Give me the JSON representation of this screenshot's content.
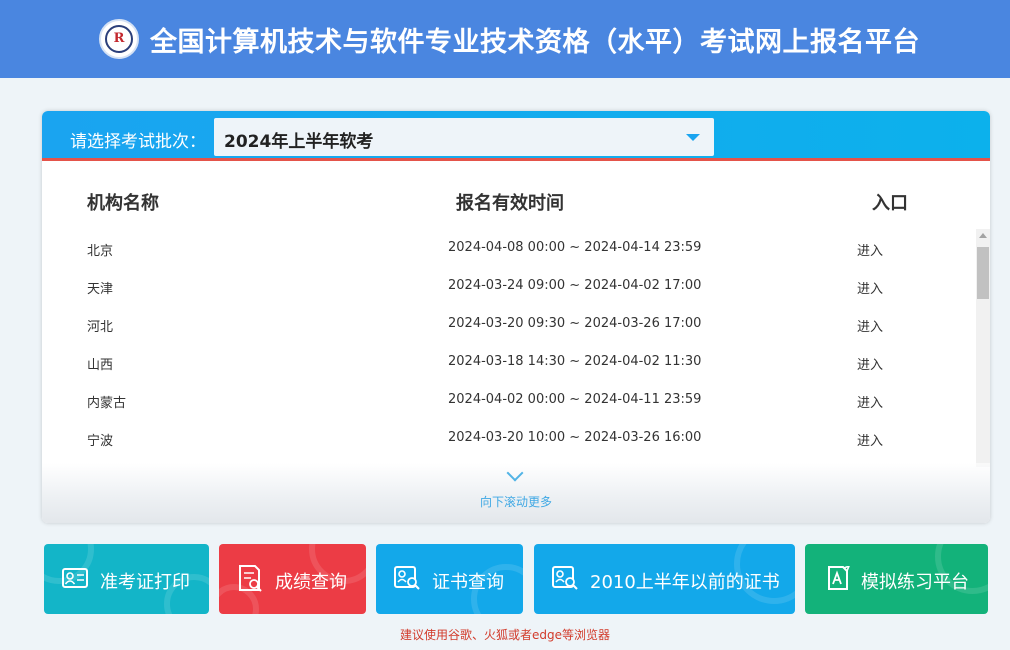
{
  "header": {
    "title": "全国计算机技术与软件专业技术资格（水平）考试网上报名平台",
    "logo_icon": "exam-logo-icon"
  },
  "batch": {
    "label": "请选择考试批次：",
    "selected": "2024年上半年软考"
  },
  "table": {
    "headers": {
      "name": "机构名称",
      "time": "报名有效时间",
      "entry": "入口"
    },
    "rows": [
      {
        "name": "北京",
        "time": "2024-04-08 00:00 ~ 2024-04-14 23:59",
        "entry": "进入"
      },
      {
        "name": "天津",
        "time": "2024-03-24 09:00 ~ 2024-04-02 17:00",
        "entry": "进入"
      },
      {
        "name": "河北",
        "time": "2024-03-20 09:30 ~ 2024-03-26 17:00",
        "entry": "进入"
      },
      {
        "name": "山西",
        "time": "2024-03-18 14:30 ~ 2024-04-02 11:30",
        "entry": "进入"
      },
      {
        "name": "内蒙古",
        "time": "2024-04-02 00:00 ~ 2024-04-11 23:59",
        "entry": "进入"
      },
      {
        "name": "宁波",
        "time": "2024-03-20 10:00 ~ 2024-03-26 16:00",
        "entry": "进入"
      }
    ],
    "more_text": "向下滚动更多"
  },
  "tiles": [
    {
      "label": "准考证打印",
      "icon": "id-card-icon",
      "color": "#13b5c8"
    },
    {
      "label": "成绩查询",
      "icon": "score-report-icon",
      "color": "#ec3c45"
    },
    {
      "label": "证书查询",
      "icon": "certificate-search-icon",
      "color": "#13a8ea"
    },
    {
      "label": "2010上半年以前的证书",
      "icon": "old-certificate-icon",
      "color": "#13a8ea"
    },
    {
      "label": "模拟练习平台",
      "icon": "practice-icon",
      "color": "#13b27a"
    }
  ],
  "tip": "建议使用谷歌、火狐或者edge等浏览器"
}
